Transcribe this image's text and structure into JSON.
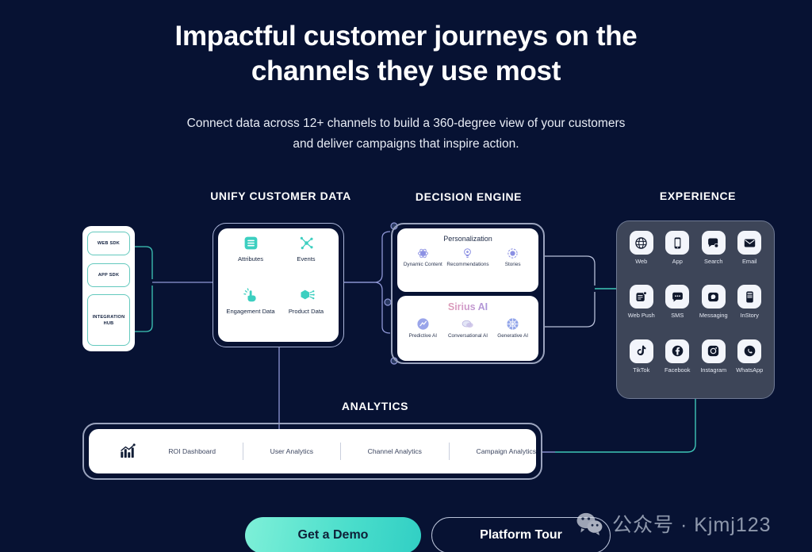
{
  "page": {
    "background_color": "#071233",
    "headline_line1": "Impactful customer journeys on the",
    "headline_line2": "channels they use most",
    "subhead_line1": "Connect data across 12+ channels to build a 360-degree view of your",
    "subhead_line2": "customers and deliver campaigns that inspire action."
  },
  "captions": {
    "unify": "UNIFY CUSTOMER DATA",
    "decision": "DECISION ENGINE",
    "experience": "EXPERIENCE",
    "analytics": "ANALYTICS"
  },
  "sources": {
    "items": [
      {
        "label": "WEB SDK",
        "icon": "web-sdk-chip"
      },
      {
        "label": "APP SDK",
        "icon": "app-sdk-chip"
      },
      {
        "label": "INTEGRATION HUB",
        "icon": "integration-hub-chip"
      }
    ]
  },
  "unify": {
    "items": [
      {
        "label": "Attributes",
        "icon": "list-attributes-icon",
        "color": "#3ccfc0"
      },
      {
        "label": "Events",
        "icon": "events-nodes-icon",
        "color": "#3ccfc0"
      },
      {
        "label": "Engagement Data",
        "icon": "engagement-tap-icon",
        "color": "#3ccfc0"
      },
      {
        "label": "Product Data",
        "icon": "product-cube-icon",
        "color": "#3ccfc0"
      }
    ]
  },
  "decision_engine": {
    "personalization": {
      "title": "Personalization",
      "items": [
        {
          "label": "Dynamic Content",
          "icon": "dynamic-content-icon",
          "color": "#7b7fe0"
        },
        {
          "label": "Recommendations",
          "icon": "recommendations-bulb-icon",
          "color": "#7b7fe0"
        },
        {
          "label": "Stories",
          "icon": "stories-circle-icon",
          "color": "#7b7fe0"
        }
      ]
    },
    "sirius": {
      "title": "Sirius AI",
      "items": [
        {
          "label": "Predictive AI",
          "icon": "predictive-ai-icon",
          "color": "#8f9ae8"
        },
        {
          "label": "Conversational AI",
          "icon": "conversational-ai-icon",
          "color": "#c3b4de"
        },
        {
          "label": "Generative AI",
          "icon": "generative-ai-icon",
          "color": "#8fa8e8"
        }
      ]
    }
  },
  "experience": {
    "channels": [
      {
        "label": "Web",
        "icon": "globe-icon"
      },
      {
        "label": "App",
        "icon": "mobile-app-icon"
      },
      {
        "label": "Search",
        "icon": "search-bubble-icon"
      },
      {
        "label": "Email",
        "icon": "envelope-icon"
      },
      {
        "label": "Web Push",
        "icon": "web-push-icon"
      },
      {
        "label": "SMS",
        "icon": "sms-bubble-icon"
      },
      {
        "label": "Messaging",
        "icon": "messaging-icon"
      },
      {
        "label": "InStory",
        "icon": "instory-icon"
      },
      {
        "label": "TikTok",
        "icon": "tiktok-icon"
      },
      {
        "label": "Facebook",
        "icon": "facebook-icon"
      },
      {
        "label": "Instagram",
        "icon": "instagram-icon"
      },
      {
        "label": "WhatsApp",
        "icon": "whatsapp-icon"
      }
    ]
  },
  "analytics": {
    "icon": "bar-chart-growth-icon",
    "links": [
      "ROI Dashboard",
      "User Analytics",
      "Channel Analytics",
      "Campaign Analytics"
    ]
  },
  "cta": {
    "primary": "Get a Demo",
    "secondary": "Platform Tour",
    "primary_color": "#49ddcb"
  },
  "watermark": {
    "icon": "wechat-icon",
    "text": "公众号 · Kjmj123"
  },
  "wire_colors": {
    "teal": "#3ec7b8",
    "violet": "#8f97d6",
    "steel": "#b6bed8"
  }
}
